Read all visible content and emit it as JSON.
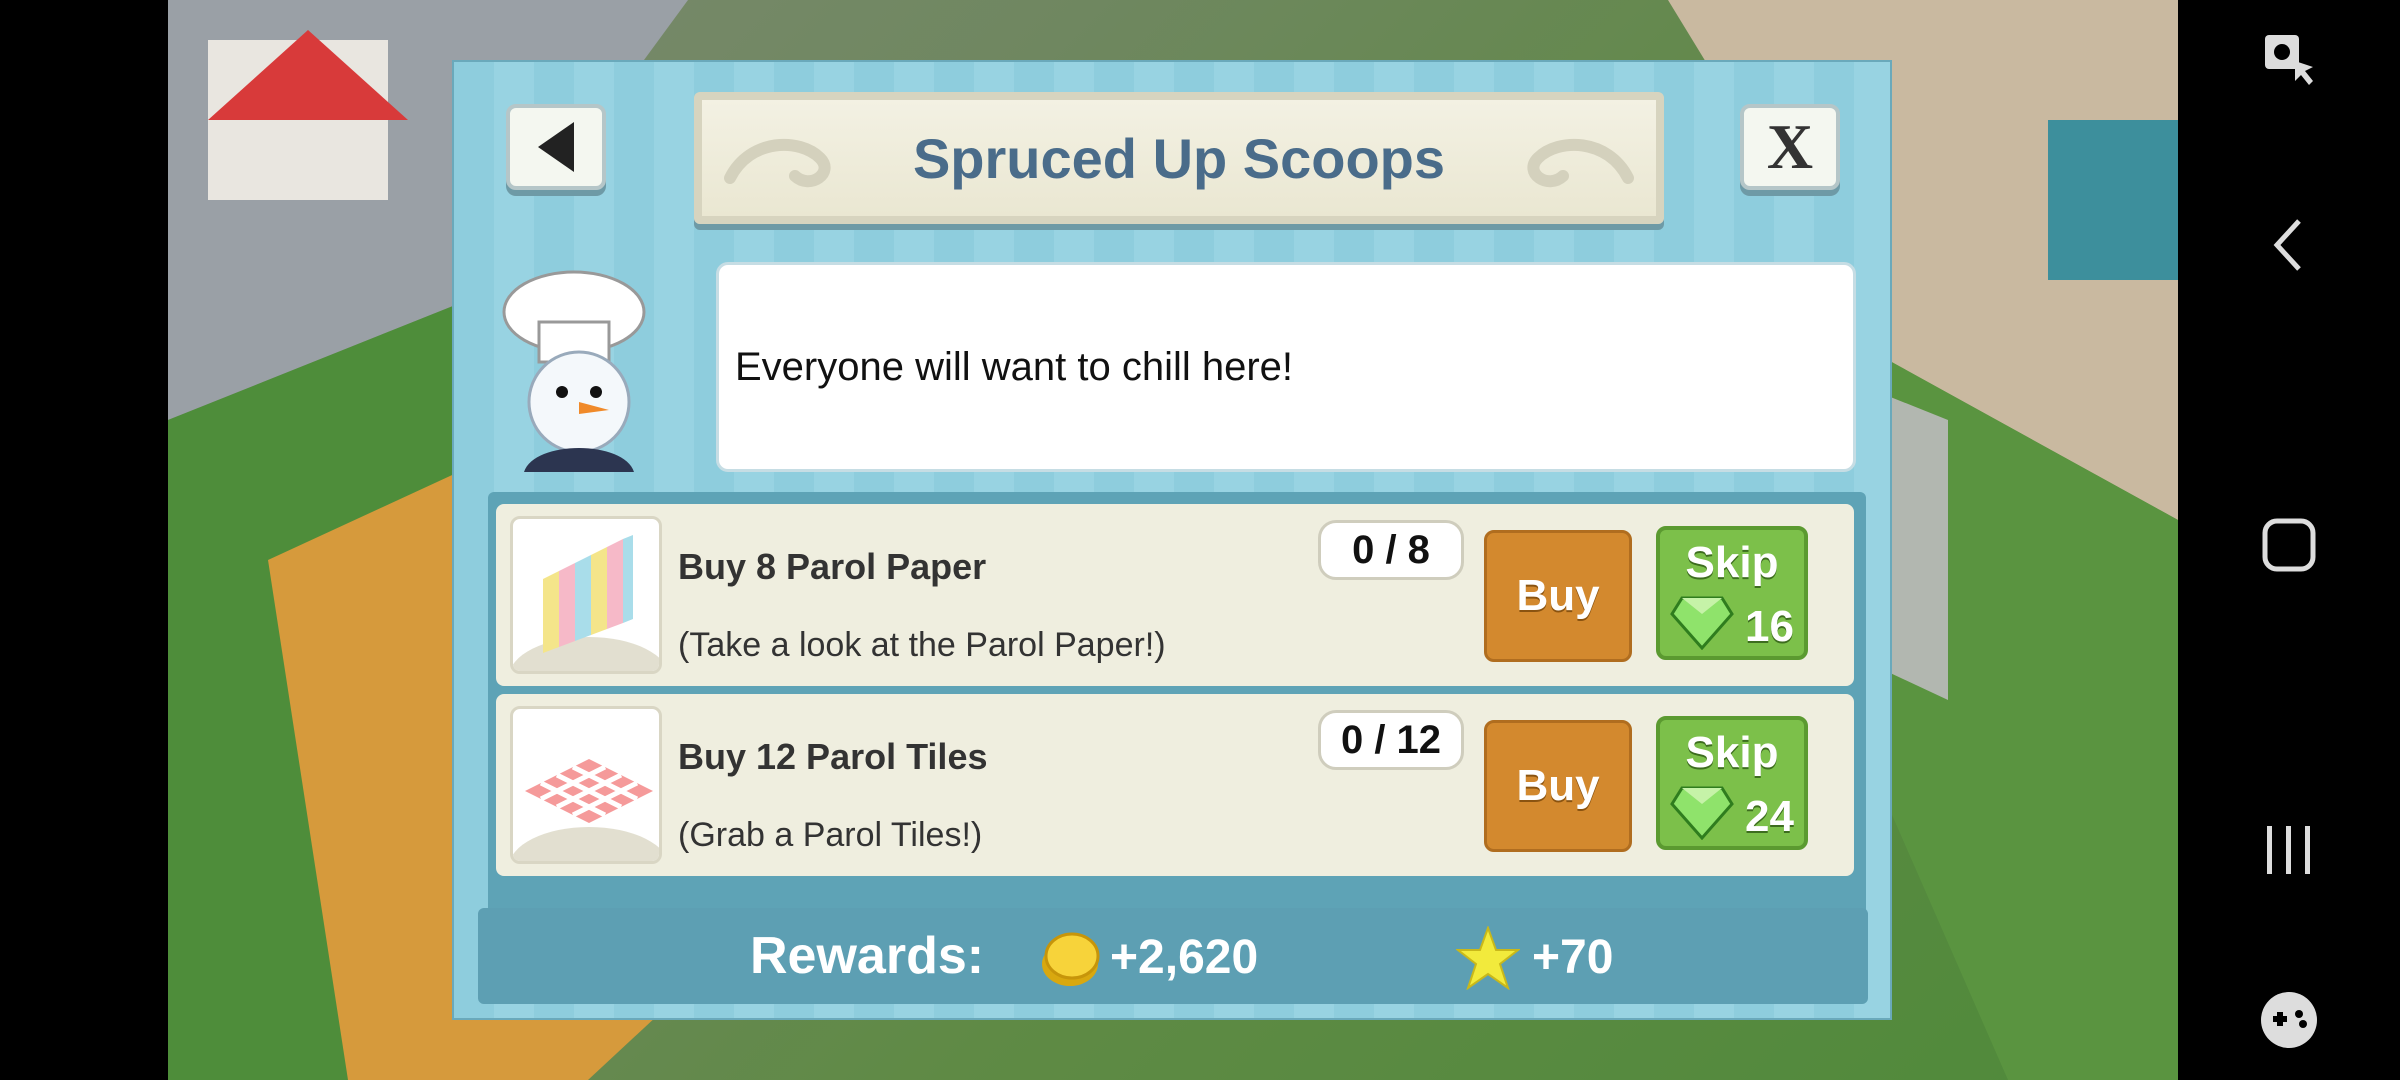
{
  "dialog": {
    "title": "Spruced Up Scoops",
    "speech": "Everyone will want to chill here!",
    "back_icon": "triangle-left-icon",
    "close_label": "X"
  },
  "tasks": [
    {
      "title": "Buy 8 Parol Paper",
      "desc": "(Take a look at the Parol Paper!)",
      "progress": "0 / 8",
      "buy_label": "Buy",
      "skip_label": "Skip",
      "skip_cost": "16"
    },
    {
      "title": "Buy 12 Parol Tiles",
      "desc": "(Grab a Parol Tiles!)",
      "progress": "0 / 12",
      "buy_label": "Buy",
      "skip_label": "Skip",
      "skip_cost": "24"
    }
  ],
  "rewards": {
    "label": "Rewards:",
    "coins": "+2,620",
    "stars": "+70"
  },
  "navbar": {
    "icons": [
      "screen-record-icon",
      "back-icon",
      "home-icon",
      "recents-icon",
      "game-tools-icon"
    ]
  },
  "colors": {
    "title": "#4a6c8a",
    "buy_button": "#d3892e",
    "skip_button": "#7cc04a",
    "panel": "#8ecddd"
  }
}
